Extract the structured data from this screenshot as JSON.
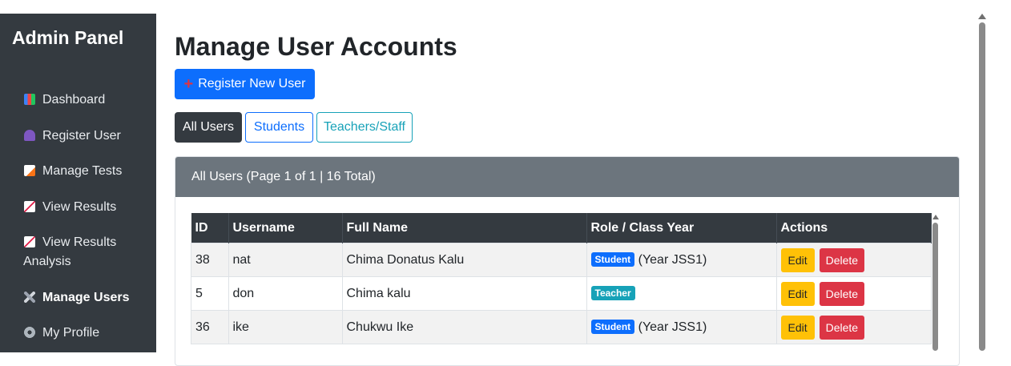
{
  "sidebar": {
    "brand": "Admin Panel",
    "items": [
      {
        "label": "Dashboard",
        "icon": "bar-chart-icon"
      },
      {
        "label": "Register User",
        "icon": "user-icon"
      },
      {
        "label": "Manage Tests",
        "icon": "memo-icon"
      },
      {
        "label": "View Results",
        "icon": "chart-up-icon"
      },
      {
        "label": "View Results",
        "label2": "Analysis",
        "icon": "chart-up-icon"
      },
      {
        "label": "Manage Users",
        "icon": "tools-icon"
      },
      {
        "label": "My Profile",
        "icon": "gear-icon"
      }
    ]
  },
  "main": {
    "title": "Manage User Accounts",
    "register_button": "Register New User",
    "tabs": [
      "All Users",
      "Students",
      "Teachers/Staff"
    ],
    "card_header": "All Users (Page 1 of 1 | 16 Total)",
    "table": {
      "headers": [
        "ID",
        "Username",
        "Full Name",
        "Role / Class Year",
        "Actions"
      ],
      "rows": [
        {
          "id": "38",
          "username": "nat",
          "full_name": "Chima Donatus Kalu",
          "role": "Student",
          "class_year": "(Year JSS1)"
        },
        {
          "id": "5",
          "username": "don",
          "full_name": "Chima kalu",
          "role": "Teacher",
          "class_year": ""
        },
        {
          "id": "36",
          "username": "ike",
          "full_name": "Chukwu Ike",
          "role": "Student",
          "class_year": "(Year JSS1)"
        }
      ],
      "edit_label": "Edit",
      "delete_label": "Delete"
    }
  },
  "colors": {
    "sidebar_bg": "#343a40",
    "primary": "#0d6efd",
    "info": "#17a2b8",
    "warning": "#ffc107",
    "danger": "#dc3545",
    "card_header_bg": "#6c757d"
  }
}
